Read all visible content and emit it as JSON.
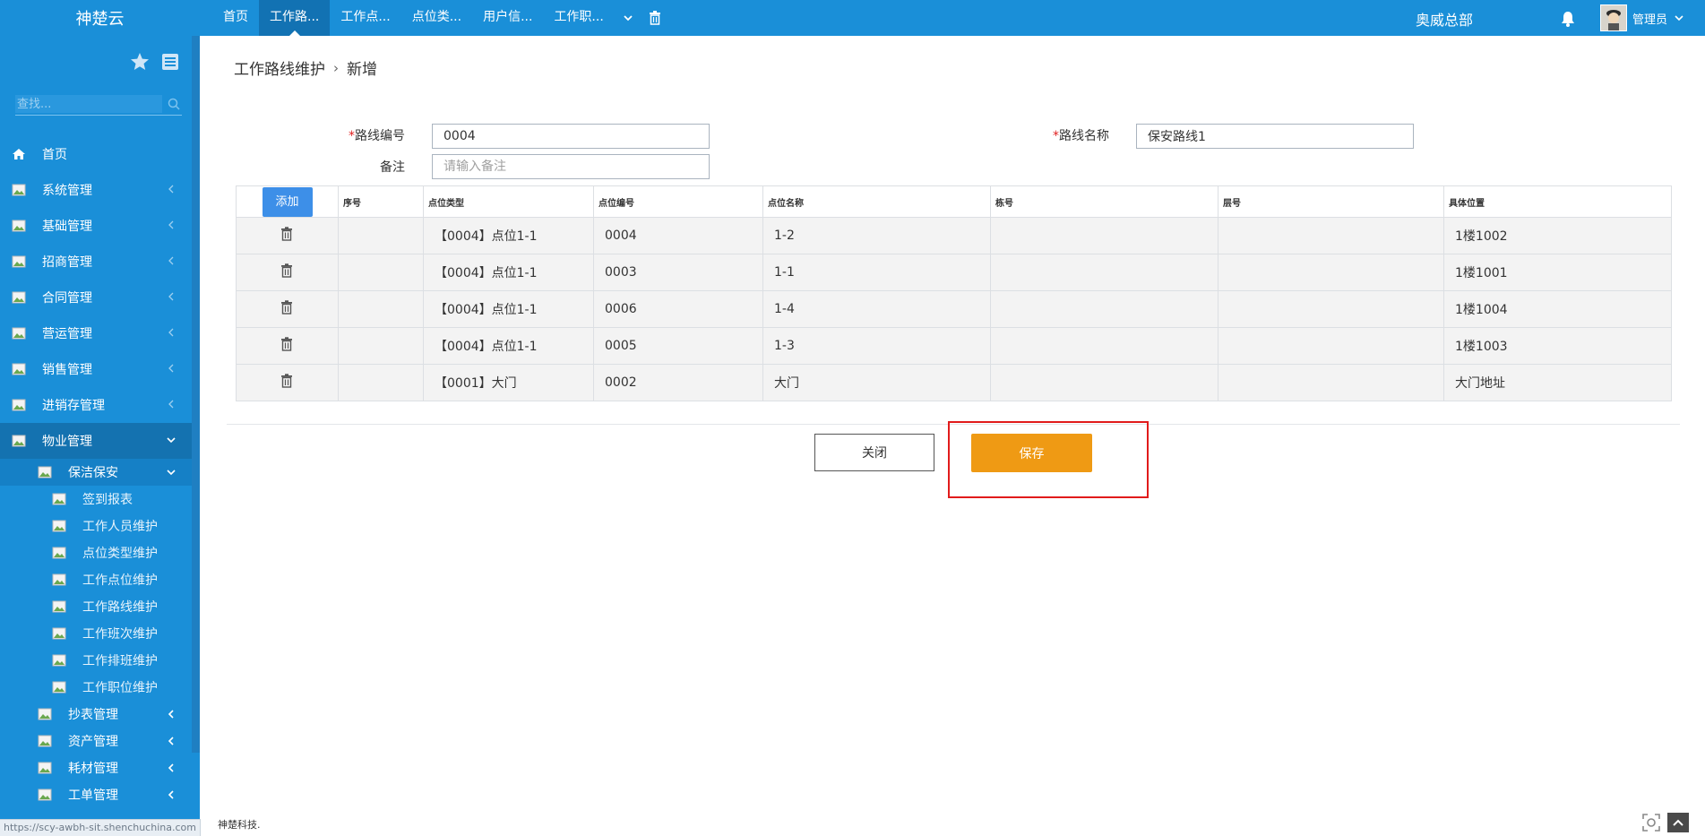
{
  "brand": "神楚云",
  "top_tabs": [
    {
      "label": "首页",
      "active": false
    },
    {
      "label": "工作路...",
      "active": true
    },
    {
      "label": "工作点...",
      "active": false
    },
    {
      "label": "点位类...",
      "active": false
    },
    {
      "label": "用户信...",
      "active": false
    },
    {
      "label": "工作职...",
      "active": false
    }
  ],
  "company": "奥威总部",
  "user": {
    "name": "管理员"
  },
  "sidebar": {
    "search_placeholder": "查找...",
    "home": "首页",
    "menus": [
      "系统管理",
      "基础管理",
      "招商管理",
      "合同管理",
      "营运管理",
      "销售管理",
      "进销存管理"
    ],
    "open_menu": "物业管理",
    "open_submenu": "保洁保安",
    "leaves": [
      "签到报表",
      "工作人员维护",
      "点位类型维护",
      "工作点位维护",
      "工作路线维护",
      "工作班次维护",
      "工作排班维护",
      "工作职位维护"
    ],
    "submenus": [
      "抄表管理",
      "资产管理",
      "耗材管理",
      "工单管理"
    ]
  },
  "breadcrumb": {
    "parent": "工作路线维护",
    "current": "新增"
  },
  "form": {
    "route_code_label": "路线编号",
    "route_code_value": "0004",
    "route_name_label": "路线名称",
    "route_name_value": "保安路线1",
    "remark_label": "备注",
    "remark_placeholder": "请输入备注"
  },
  "grid": {
    "add_label": "添加",
    "columns": [
      "序号",
      "点位类型",
      "点位编号",
      "点位名称",
      "栋号",
      "层号",
      "具体位置"
    ],
    "rows": [
      {
        "seq": "",
        "type": "【0004】点位1-1",
        "code": "0004",
        "name": "1-2",
        "building": "",
        "floor": "",
        "location": "1楼1002"
      },
      {
        "seq": "",
        "type": "【0004】点位1-1",
        "code": "0003",
        "name": "1-1",
        "building": "",
        "floor": "",
        "location": "1楼1001"
      },
      {
        "seq": "",
        "type": "【0004】点位1-1",
        "code": "0006",
        "name": "1-4",
        "building": "",
        "floor": "",
        "location": "1楼1004"
      },
      {
        "seq": "",
        "type": "【0004】点位1-1",
        "code": "0005",
        "name": "1-3",
        "building": "",
        "floor": "",
        "location": "1楼1003"
      },
      {
        "seq": "",
        "type": "【0001】大门",
        "code": "0002",
        "name": "大门",
        "building": "",
        "floor": "",
        "location": "大门地址"
      }
    ]
  },
  "actions": {
    "close": "关闭",
    "save": "保存"
  },
  "footer": "神楚科技.",
  "status_url": "https://scy-awbh-sit.shenchuchina.com",
  "colors": {
    "primary": "#1a8fd8",
    "save": "#ef9a14",
    "highlight": "#e11b1b",
    "add": "#3d8fe8"
  }
}
